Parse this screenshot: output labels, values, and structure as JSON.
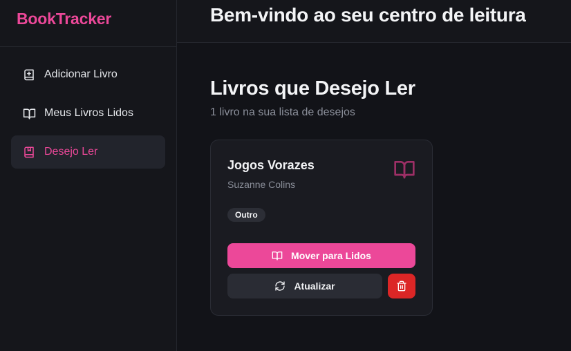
{
  "app": {
    "brand": "BookTracker",
    "accent": "#ec4899"
  },
  "header": {
    "title": "Bem-vindo ao seu centro de leitura"
  },
  "sidebar": {
    "items": [
      {
        "label": "Adicionar Livro",
        "icon": "book-plus-icon",
        "active": false
      },
      {
        "label": "Meus Livros Lidos",
        "icon": "book-open-icon",
        "active": false
      },
      {
        "label": "Desejo Ler",
        "icon": "bookmark-book-icon",
        "active": true
      }
    ]
  },
  "main": {
    "title": "Livros que Desejo Ler",
    "subtitle": "1 livro na sua lista de desejos",
    "books": [
      {
        "title": "Jogos Vorazes",
        "author": "Suzanne Colins",
        "genre": "Outro",
        "move_label": "Mover para Lidos",
        "update_label": "Atualizar",
        "delete_icon": "trash-icon"
      }
    ]
  },
  "colors": {
    "delete": "#dc2626",
    "secondary_button": "#2a2c34"
  }
}
